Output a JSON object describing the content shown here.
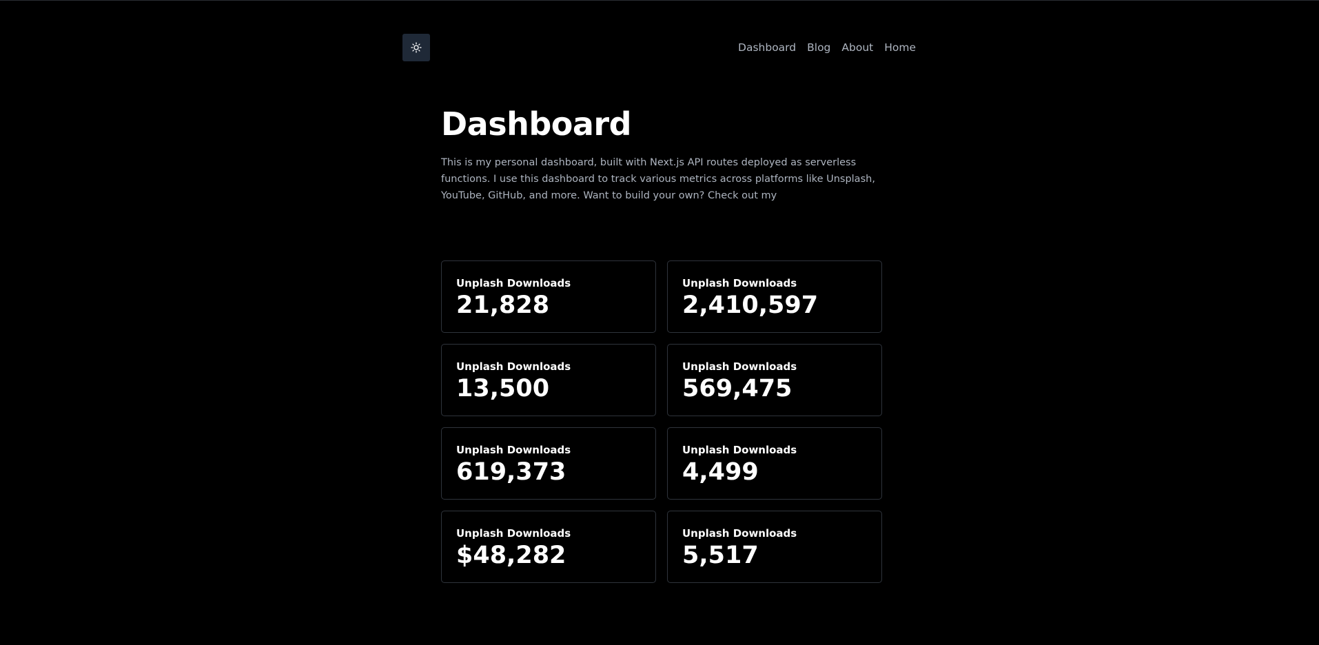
{
  "header": {
    "theme_toggle_icon": "sun-icon",
    "nav": [
      {
        "label": "Dashboard"
      },
      {
        "label": "Blog"
      },
      {
        "label": "About"
      },
      {
        "label": "Home"
      }
    ]
  },
  "main": {
    "title": "Dashboard",
    "intro": "This is my personal dashboard, built with Next.js API routes deployed as serverless functions. I use this dashboard to track various metrics across platforms like Unsplash, YouTube, GitHub, and more. Want to build your own? Check out my"
  },
  "cards": [
    {
      "label": "Unplash Downloads",
      "value": "21,828"
    },
    {
      "label": "Unplash Downloads",
      "value": "2,410,597"
    },
    {
      "label": "Unplash Downloads",
      "value": "13,500"
    },
    {
      "label": "Unplash Downloads",
      "value": "569,475"
    },
    {
      "label": "Unplash Downloads",
      "value": "619,373"
    },
    {
      "label": "Unplash Downloads",
      "value": "4,499"
    },
    {
      "label": "Unplash Downloads",
      "value": "$48,282"
    },
    {
      "label": "Unplash Downloads",
      "value": "5,517"
    }
  ],
  "colors": {
    "background": "#000000",
    "toggle_bg": "#1f2937",
    "nav_text": "#aeb5c0",
    "card_border": "#2f343c"
  }
}
